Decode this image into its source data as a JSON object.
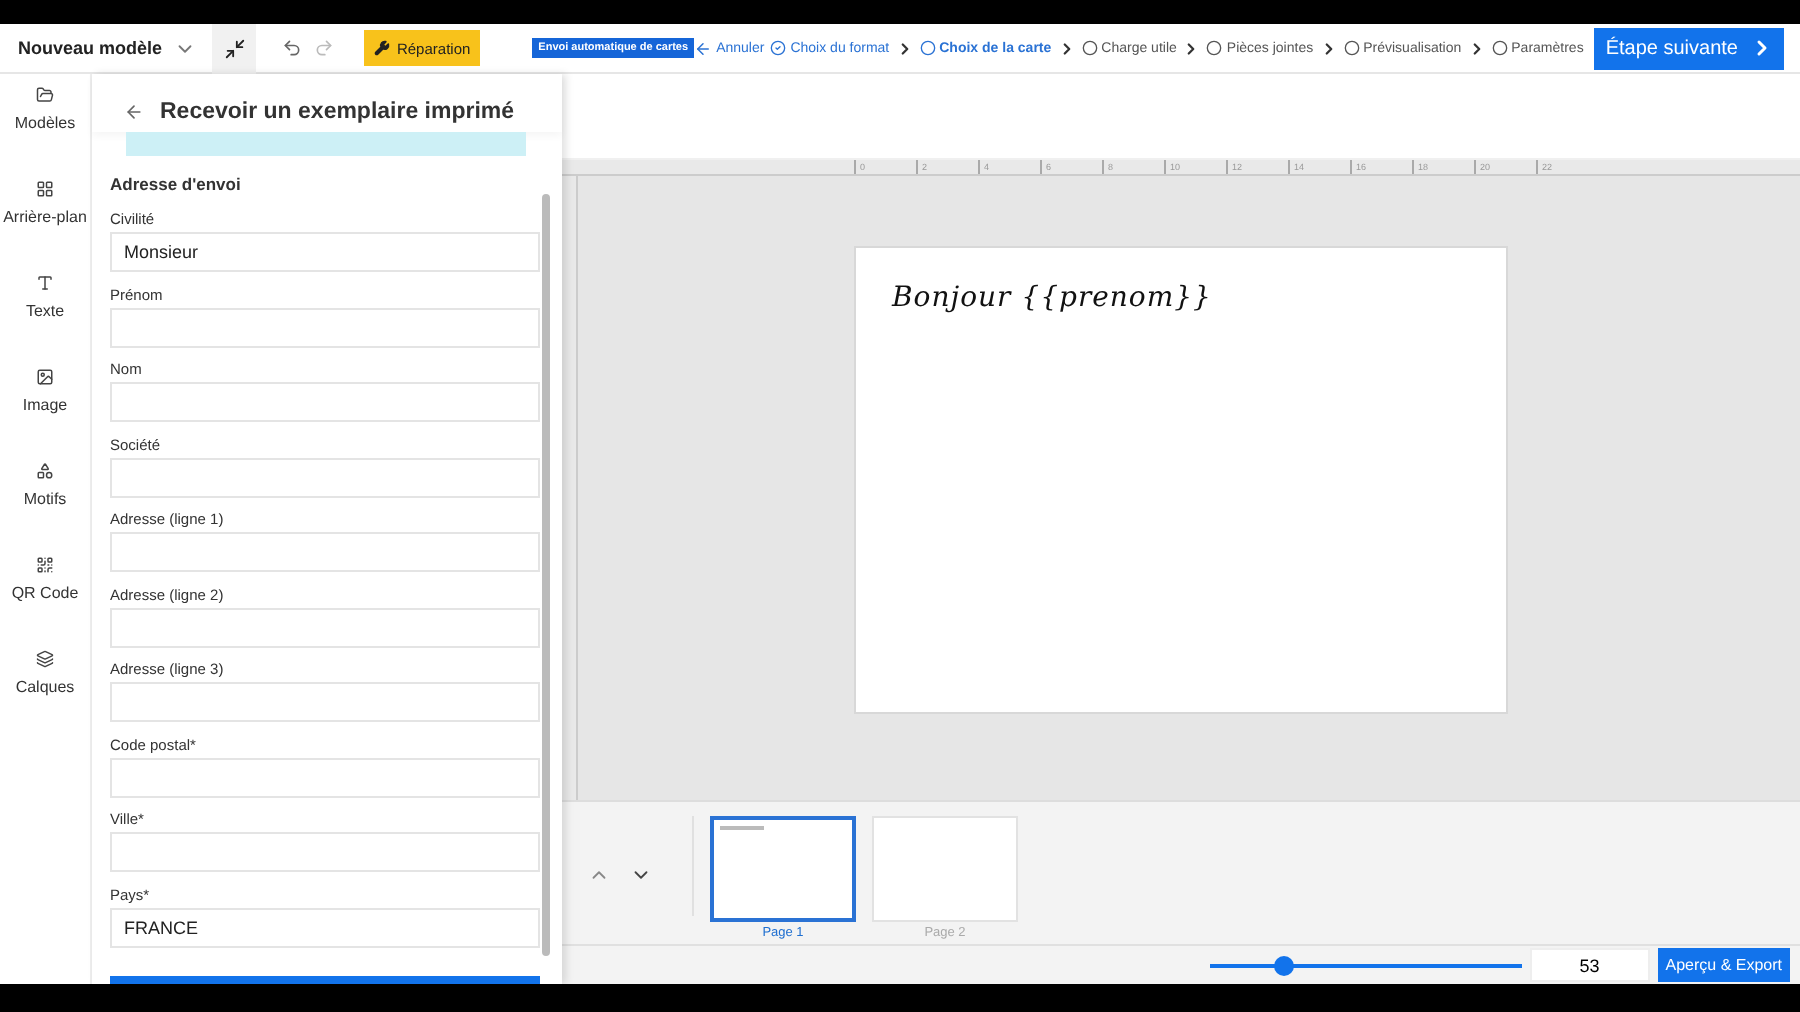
{
  "toolbar": {
    "document_title": "Nouveau modèle",
    "repair_button": "Réparation",
    "badge": "Envoi automatique de cartes",
    "cancel": "Annuler",
    "steps": [
      {
        "label": "Choix du format",
        "done": true,
        "selected": false
      },
      {
        "label": "Choix de la carte",
        "done": false,
        "selected": true
      },
      {
        "label": "Charge utile",
        "done": false,
        "selected": false
      },
      {
        "label": "Pièces jointes",
        "done": false,
        "selected": false
      },
      {
        "label": "Prévisualisation",
        "done": false,
        "selected": false
      },
      {
        "label": "Paramètres",
        "done": false,
        "selected": false
      }
    ],
    "next_button": "Étape suivante"
  },
  "sidebar": {
    "items": [
      {
        "label": "Modèles",
        "kind": "folder"
      },
      {
        "label": "Arrière-plan",
        "kind": "grid"
      },
      {
        "label": "Texte",
        "kind": "text"
      },
      {
        "label": "Image",
        "kind": "image"
      },
      {
        "label": "Motifs",
        "kind": "shapes"
      },
      {
        "label": "QR Code",
        "kind": "qr"
      },
      {
        "label": "Calques",
        "kind": "layers"
      }
    ]
  },
  "panel": {
    "title": "Recevoir un exemplaire imprimé",
    "section": "Adresse d'envoi",
    "fields": [
      {
        "label": "Civilité",
        "value": "Monsieur"
      },
      {
        "label": "Prénom"
      },
      {
        "label": "Nom"
      },
      {
        "label": "Société"
      },
      {
        "label": "Adresse (ligne 1)"
      },
      {
        "label": "Adresse (ligne 2)"
      },
      {
        "label": "Adresse (ligne 3)"
      },
      {
        "label": "Code postal*"
      },
      {
        "label": "Ville*"
      },
      {
        "label": "Pays*",
        "value": "FRANCE"
      }
    ]
  },
  "ruler": [
    "0",
    "2",
    "4",
    "6",
    "8",
    "10",
    "12",
    "14",
    "16",
    "18",
    "20",
    "22"
  ],
  "card": {
    "text": "Bonjour {{prenom}}"
  },
  "pages": [
    {
      "label": "Page 1",
      "selected": true
    },
    {
      "label": "Page 2",
      "selected": false
    }
  ],
  "zoom": {
    "level": 0.24,
    "value": "53"
  },
  "export_button": "Aperçu & Export"
}
